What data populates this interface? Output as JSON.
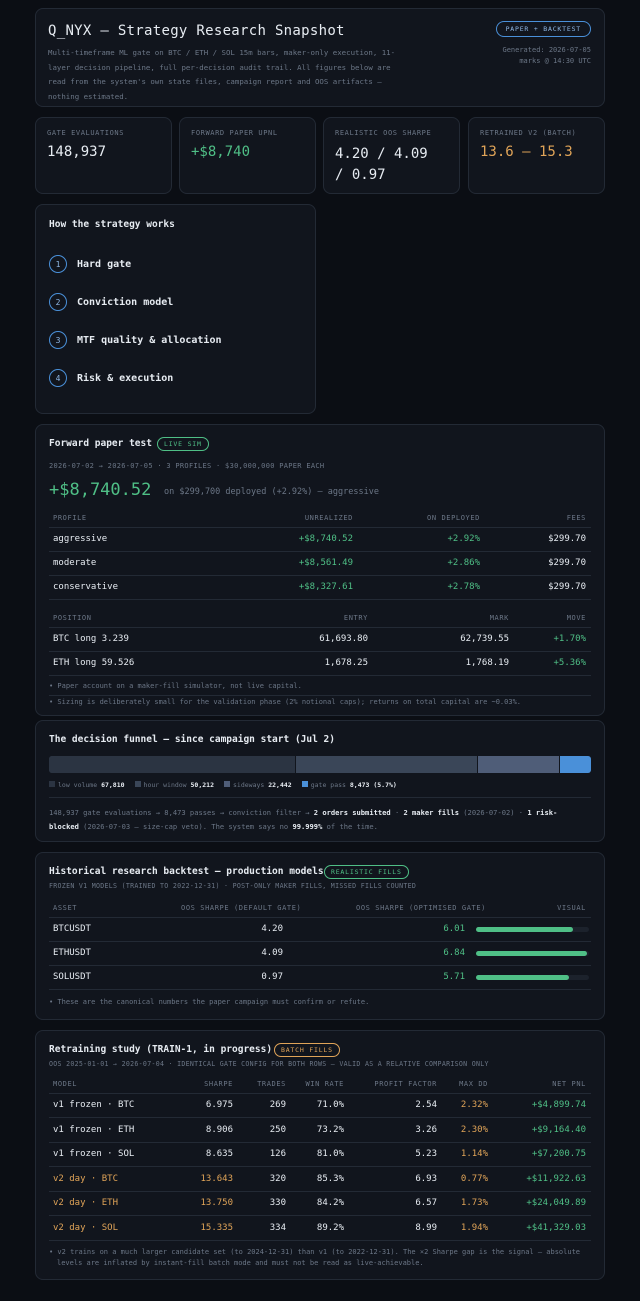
{
  "header": {
    "title": "Q_NYX — Strategy Research Snapshot",
    "subtitle_lines": [
      "Multi-timeframe ML gate on BTC / ETH / SOL 15m bars, maker-only execution, 11-",
      "layer decision pipeline, full per-decision audit trail. All figures below are",
      "read from the system's own state files, campaign report and OOS artifacts —",
      "nothing estimated."
    ],
    "badge": "PAPER + BACKTEST",
    "generated_line1": "Generated: 2026-07-05",
    "generated_line2": "marks @ 14:30 UTC"
  },
  "kpis": [
    {
      "label": "GATE EVALUATIONS",
      "value": "148,937",
      "value2": ""
    },
    {
      "label": "FORWARD PAPER UPNL",
      "value": "+$8,740",
      "value2": ""
    },
    {
      "label": "REALISTIC OOS SHARPE",
      "value": "4.20 / 4.09",
      "value2": "/ 0.97"
    },
    {
      "label": "RETRAINED V2 (BATCH)",
      "value": "13.6 – 15.3",
      "value2": ""
    }
  ],
  "how": {
    "title": "How the strategy works",
    "steps": [
      {
        "num": "1",
        "label": "Hard gate"
      },
      {
        "num": "2",
        "label": "Conviction model"
      },
      {
        "num": "3",
        "label": "MTF quality & allocation"
      },
      {
        "num": "4",
        "label": "Risk & execution"
      }
    ]
  },
  "forward": {
    "title": "Forward paper test",
    "badge": "LIVE SIM",
    "meta": "2026-07-02 → 2026-07-05 · 3 PROFILES · $30,000,000 PAPER EACH",
    "big_value": "+$8,740.52",
    "big_sub": "on $299,700 deployed (+2.92%) — aggressive",
    "profile_headers": [
      "PROFILE",
      "UNREALIZED",
      "ON DEPLOYED",
      "FEES"
    ],
    "profiles": [
      {
        "name": "aggressive",
        "unrealized": "+$8,740.52",
        "on_deployed": "+2.92%",
        "fees": "$299.70"
      },
      {
        "name": "moderate",
        "unrealized": "+$8,561.49",
        "on_deployed": "+2.86%",
        "fees": "$299.70"
      },
      {
        "name": "conservative",
        "unrealized": "+$8,327.61",
        "on_deployed": "+2.78%",
        "fees": "$299.70"
      }
    ],
    "position_headers": [
      "POSITION",
      "ENTRY",
      "MARK",
      "MOVE"
    ],
    "positions": [
      {
        "name": "BTC long 3.239",
        "entry": "61,693.80",
        "mark": "62,739.55",
        "move": "+1.70%"
      },
      {
        "name": "ETH long 59.526",
        "entry": "1,678.25",
        "mark": "1,768.19",
        "move": "+5.36%"
      }
    ],
    "notes": [
      "• Paper account on a maker-fill simulator, not live capital.",
      "• Sizing is deliberately small for the validation phase (2% notional caps); returns on total capital are ~0.03%."
    ]
  },
  "funnel": {
    "title": "The decision funnel — since campaign start (Jul 2)",
    "segments": [
      {
        "label": "low volume",
        "value": "67,810",
        "count": 67810,
        "color": "#2b3442"
      },
      {
        "label": "hour window",
        "value": "50,212",
        "count": 50212,
        "color": "#3a4658"
      },
      {
        "label": "sideways",
        "value": "22,442",
        "count": 22442,
        "color": "#4f5d78"
      },
      {
        "label": "gate pass",
        "value": "8,473 (5.7%)",
        "count": 8473,
        "color": "#4a90d9"
      }
    ],
    "text1_a": "148,937 gate evaluations → 8,473 passes → conviction filter → ",
    "text1_b": "2 orders submitted",
    "text1_c": " · ",
    "text1_d": "2 maker fills",
    "text1_e": " (2026-07-02) · ",
    "text1_f": "1 risk-",
    "text2_a": "blocked",
    "text2_b": " (2026-07-03 — size-cap veto). The system says no ",
    "text2_c": "99.999%",
    "text2_d": " of the time."
  },
  "historical": {
    "title": "Historical research backtest — production models",
    "badge": "REALISTIC FILLS",
    "meta": "FROZEN V1 MODELS (TRAINED TO 2022-12-31) · POST-ONLY MAKER FILLS, MISSED FILLS COUNTED",
    "headers": [
      "ASSET",
      "OOS SHARPE (DEFAULT GATE)",
      "OOS SHARPE (OPTIMISED GATE)",
      "VISUAL"
    ],
    "rows": [
      {
        "asset": "BTCUSDT",
        "default": "4.20",
        "optimised": "6.01",
        "bar": 0.86
      },
      {
        "asset": "ETHUSDT",
        "default": "4.09",
        "optimised": "6.84",
        "bar": 0.98
      },
      {
        "asset": "SOLUSDT",
        "default": "0.97",
        "optimised": "5.71",
        "bar": 0.82
      }
    ],
    "note": "• These are the canonical numbers the paper campaign must confirm or refute."
  },
  "retrain": {
    "title": "Retraining study (TRAIN-1, in progress)",
    "badge": "BATCH FILLS",
    "meta": "OOS 2025-01-01 → 2026-07-04 · IDENTICAL GATE CONFIG FOR BOTH ROWS — VALID AS A RELATIVE COMPARISON ONLY",
    "headers": [
      "MODEL",
      "SHARPE",
      "TRADES",
      "WIN RATE",
      "PROFIT FACTOR",
      "MAX DD",
      "NET PNL"
    ],
    "rows": [
      {
        "model": "v1 frozen · BTC",
        "sharpe": "6.975",
        "trades": "269",
        "win": "71.0%",
        "pf": "2.54",
        "dd": "2.32%",
        "pnl": "+$4,899.74",
        "v2": false
      },
      {
        "model": "v1 frozen · ETH",
        "sharpe": "8.906",
        "trades": "250",
        "win": "73.2%",
        "pf": "3.26",
        "dd": "2.30%",
        "pnl": "+$9,164.40",
        "v2": false
      },
      {
        "model": "v1 frozen · SOL",
        "sharpe": "8.635",
        "trades": "126",
        "win": "81.0%",
        "pf": "5.23",
        "dd": "1.14%",
        "pnl": "+$7,200.75",
        "v2": false
      },
      {
        "model": "v2 day · BTC",
        "sharpe": "13.643",
        "trades": "320",
        "win": "85.3%",
        "pf": "6.93",
        "dd": "0.77%",
        "pnl": "+$11,922.63",
        "v2": true
      },
      {
        "model": "v2 day · ETH",
        "sharpe": "13.750",
        "trades": "330",
        "win": "84.2%",
        "pf": "6.57",
        "dd": "1.73%",
        "pnl": "+$24,049.89",
        "v2": true
      },
      {
        "model": "v2 day · SOL",
        "sharpe": "15.335",
        "trades": "334",
        "win": "89.2%",
        "pf": "8.99",
        "dd": "1.94%",
        "pnl": "+$41,329.03",
        "v2": true
      }
    ],
    "note_lines": [
      "• v2 trains on a much larger candidate set (to 2024-12-31) than v1 (to 2022-12-31). The ×2 Sharpe gap is the signal — absolute",
      "levels are inflated by instant-fill batch mode and must not be read as live-achievable."
    ]
  },
  "colors": {
    "accent": "#4a90d9",
    "positive": "#4fbf86",
    "warning": "#e0a458",
    "background": "#0b0e14",
    "card": "#11151d"
  }
}
